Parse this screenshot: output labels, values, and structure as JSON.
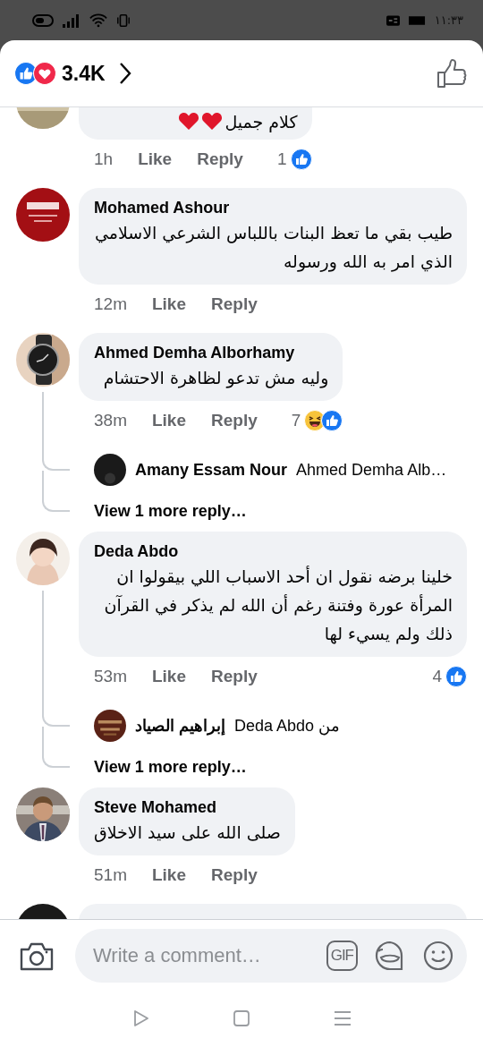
{
  "status_bar": {
    "time": "١١:٣٣"
  },
  "header": {
    "reactions": [
      {
        "kind": "like"
      },
      {
        "kind": "love"
      }
    ],
    "count": "3.4K"
  },
  "comments": [
    {
      "kind": "comment",
      "text": "كلام جميل",
      "emoji": [
        {
          "kind": "heart"
        },
        {
          "kind": "heart"
        }
      ],
      "time": "1h",
      "like": "Like",
      "reply": "Reply",
      "reaction_count": "1",
      "reactions": [
        {
          "kind": "like"
        }
      ]
    },
    {
      "kind": "comment",
      "author": "Mohamed Ashour",
      "text": "طيب بقي ما تعظ البنات باللباس الشرعي الاسلامي الذي امر به الله ورسوله",
      "time": "12m",
      "like": "Like",
      "reply": "Reply"
    },
    {
      "kind": "comment",
      "author": "Ahmed Demha Alborhamy",
      "text": "وليه مش تدعو لظاهرة الاحتشام",
      "time": "38m",
      "like": "Like",
      "reply": "Reply",
      "reaction_count": "7",
      "reactions": [
        {
          "kind": "haha"
        },
        {
          "kind": "like"
        }
      ],
      "replies": [
        {
          "name": "Amany Essam Nour",
          "text": "Ahmed Demha Alb…"
        }
      ],
      "view_more": "View 1 more reply…"
    },
    {
      "kind": "comment",
      "author": "Deda Abdo",
      "text": "خلينا برضه نقول ان أحد الاسباب اللي بيقولوا ان المرأة عورة وفتنة رغم أن الله لم يذكر في القرآن ذلك ولم يسيء لها",
      "time": "53m",
      "like": "Like",
      "reply": "Reply",
      "reaction_count": "4",
      "reactions": [
        {
          "kind": "like"
        }
      ],
      "replies": [
        {
          "name": "إبراهيم الصياد",
          "text": "Deda Abdo من"
        }
      ],
      "view_more": "View 1 more reply…"
    },
    {
      "kind": "comment",
      "author": "Steve Mohamed",
      "text": "صلى الله على سيد الاخلاق",
      "time": "51m",
      "like": "Like",
      "reply": "Reply"
    },
    {
      "kind": "cut_off"
    }
  ],
  "composer": {
    "placeholder": "Write a comment…",
    "gif": "GIF"
  }
}
